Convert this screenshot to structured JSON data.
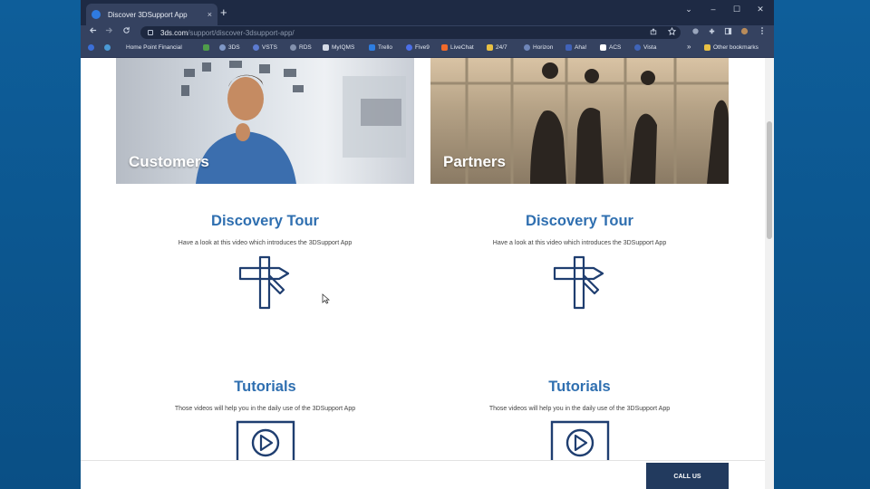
{
  "browser": {
    "tab_title": "Discover 3DSupport App",
    "tab_close": "×",
    "new_tab": "+",
    "controls": {
      "chevron": "⌄",
      "minimize": "–",
      "maximize": "☐",
      "close": "✕"
    },
    "url_host": "3ds.com",
    "url_path": "/support/discover-3dsupport-app/",
    "bookmarks": [
      {
        "label": "Home Point Financial"
      },
      {
        "label": "3DS"
      },
      {
        "label": "VSTS"
      },
      {
        "label": "RDS"
      },
      {
        "label": "MyIQMS"
      },
      {
        "label": "Trello"
      },
      {
        "label": "Five9"
      },
      {
        "label": "LiveChat"
      },
      {
        "label": "24/7"
      },
      {
        "label": "Horizon"
      },
      {
        "label": "Aha!"
      },
      {
        "label": "ACS"
      },
      {
        "label": "Vista"
      }
    ],
    "more_bookmarks": "»",
    "other_bookmarks": "Other bookmarks"
  },
  "page": {
    "cards": [
      {
        "label": "Customers"
      },
      {
        "label": "Partners"
      }
    ],
    "discovery": {
      "title": "Discovery Tour",
      "desc": "Have a look at this video which introduces the 3DSupport App"
    },
    "tutorials": {
      "title": "Tutorials",
      "desc": "Those videos will help you in the daily use of the 3DSupport App"
    },
    "call_us": "CALL US"
  },
  "colors": {
    "accent": "#2f6fb0",
    "icon_navy": "#1f3e70",
    "call_us_bg": "#223a5e",
    "desktop": "#0d5b96"
  },
  "icons": [
    "signpost-icon",
    "play-video-icon",
    "lock-icon",
    "star-icon",
    "extensions-icon",
    "menu-icon",
    "back-arrow-icon",
    "forward-arrow-icon",
    "reload-icon"
  ]
}
